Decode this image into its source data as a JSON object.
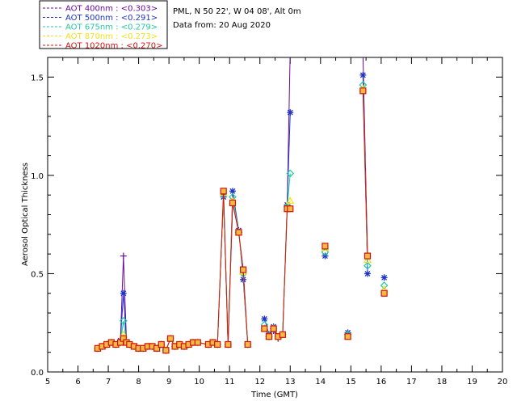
{
  "chart_data": {
    "type": "line",
    "title_lines": [
      "PML, N 50 22', W 04 08', Alt 0m",
      "Data from: 20 Aug 2020"
    ],
    "xlabel": "Time (GMT)",
    "ylabel": "Aerosol Optical Thickness",
    "xlim": [
      5,
      20
    ],
    "ylim": [
      0.0,
      1.6
    ],
    "xticks": [
      "5",
      "6",
      "7",
      "8",
      "9",
      "10",
      "11",
      "12",
      "13",
      "14",
      "15",
      "16",
      "17",
      "18",
      "19",
      "20"
    ],
    "yticks": [
      "0.0",
      "0.5",
      "1.0",
      "1.5"
    ],
    "legend_position": "top-left",
    "grid": false,
    "series": [
      {
        "name": "AOT 400nm : <0.303>",
        "color": "#6a0a9c",
        "marker": "plus",
        "points": [
          [
            6.65,
            0.12
          ],
          [
            6.8,
            0.13
          ],
          [
            6.95,
            0.14
          ],
          [
            7.1,
            0.15
          ],
          [
            7.25,
            0.14
          ],
          [
            7.4,
            0.16
          ],
          [
            7.5,
            0.59
          ],
          [
            7.6,
            0.15
          ],
          [
            7.7,
            0.14
          ],
          [
            7.85,
            0.13
          ],
          [
            8.0,
            0.12
          ],
          [
            8.15,
            0.12
          ],
          [
            8.3,
            0.13
          ],
          [
            8.45,
            0.13
          ],
          [
            8.6,
            0.12
          ],
          [
            8.75,
            0.14
          ],
          [
            8.9,
            0.11
          ],
          [
            9.05,
            0.17
          ],
          [
            9.2,
            0.13
          ],
          [
            9.35,
            0.14
          ],
          [
            9.5,
            0.13
          ],
          [
            9.65,
            0.14
          ],
          [
            9.8,
            0.15
          ],
          [
            9.95,
            0.15
          ],
          [
            10.3,
            0.14
          ],
          [
            10.45,
            0.15
          ],
          [
            10.6,
            0.14
          ],
          [
            10.8,
            0.9
          ],
          [
            10.95,
            0.14
          ],
          [
            11.1,
            0.86
          ],
          [
            11.3,
            0.71
          ],
          [
            11.45,
            0.52
          ],
          [
            11.6,
            0.14
          ],
          [
            null,
            null
          ],
          [
            12.15,
            0.22
          ],
          [
            12.3,
            0.19
          ],
          [
            12.45,
            0.21
          ],
          [
            12.6,
            0.17
          ],
          [
            12.75,
            0.19
          ],
          [
            12.9,
            0.83
          ],
          [
            13.0,
            1.65
          ],
          [
            null,
            null
          ],
          [
            15.4,
            1.62
          ],
          [
            15.55,
            0.59
          ]
        ]
      },
      {
        "name": "AOT 500nm : <0.291>",
        "color": "#1f34c9",
        "marker": "asterisk",
        "points": [
          [
            6.65,
            0.12
          ],
          [
            6.8,
            0.13
          ],
          [
            6.95,
            0.14
          ],
          [
            7.1,
            0.15
          ],
          [
            7.25,
            0.14
          ],
          [
            7.4,
            0.16
          ],
          [
            7.5,
            0.4
          ],
          [
            7.6,
            0.15
          ],
          [
            7.7,
            0.14
          ],
          [
            7.85,
            0.13
          ],
          [
            8.0,
            0.12
          ],
          [
            8.15,
            0.12
          ],
          [
            8.3,
            0.13
          ],
          [
            8.45,
            0.13
          ],
          [
            8.6,
            0.12
          ],
          [
            8.75,
            0.14
          ],
          [
            8.9,
            0.11
          ],
          [
            9.05,
            0.17
          ],
          [
            9.2,
            0.13
          ],
          [
            9.35,
            0.14
          ],
          [
            9.5,
            0.13
          ],
          [
            9.65,
            0.14
          ],
          [
            9.8,
            0.15
          ],
          [
            9.95,
            0.15
          ],
          [
            10.3,
            0.14
          ],
          [
            10.45,
            0.15
          ],
          [
            10.6,
            0.14
          ],
          [
            10.8,
            0.89
          ],
          [
            10.95,
            0.14
          ],
          [
            11.1,
            0.92
          ],
          [
            11.3,
            0.72
          ],
          [
            11.45,
            0.47
          ],
          [
            11.6,
            0.14
          ],
          [
            null,
            null
          ],
          [
            12.15,
            0.27
          ],
          [
            12.3,
            0.19
          ],
          [
            12.45,
            0.23
          ],
          [
            12.6,
            0.18
          ],
          [
            12.75,
            0.19
          ],
          [
            12.9,
            0.85
          ],
          [
            13.0,
            1.32
          ],
          [
            null,
            null
          ],
          [
            14.15,
            0.59
          ],
          [
            null,
            null
          ],
          [
            14.9,
            0.2
          ],
          [
            null,
            null
          ],
          [
            15.4,
            1.51
          ],
          [
            15.55,
            0.5
          ],
          [
            null,
            null
          ],
          [
            16.1,
            0.48
          ]
        ]
      },
      {
        "name": "AOT 675nm : <0.279>",
        "color": "#22c9a0",
        "marker": "diamond",
        "points": [
          [
            6.65,
            0.12
          ],
          [
            6.8,
            0.13
          ],
          [
            6.95,
            0.14
          ],
          [
            7.1,
            0.15
          ],
          [
            7.25,
            0.14
          ],
          [
            7.4,
            0.15
          ],
          [
            7.5,
            0.26
          ],
          [
            7.6,
            0.15
          ],
          [
            7.7,
            0.14
          ],
          [
            7.85,
            0.13
          ],
          [
            8.0,
            0.12
          ],
          [
            8.15,
            0.12
          ],
          [
            8.3,
            0.13
          ],
          [
            8.45,
            0.13
          ],
          [
            8.6,
            0.12
          ],
          [
            8.75,
            0.14
          ],
          [
            8.9,
            0.11
          ],
          [
            9.05,
            0.17
          ],
          [
            9.2,
            0.13
          ],
          [
            9.35,
            0.14
          ],
          [
            9.5,
            0.13
          ],
          [
            9.65,
            0.14
          ],
          [
            9.8,
            0.15
          ],
          [
            9.95,
            0.15
          ],
          [
            10.3,
            0.14
          ],
          [
            10.45,
            0.15
          ],
          [
            10.6,
            0.14
          ],
          [
            10.8,
            0.9
          ],
          [
            10.95,
            0.14
          ],
          [
            11.1,
            0.89
          ],
          [
            11.3,
            0.71
          ],
          [
            11.45,
            0.5
          ],
          [
            11.6,
            0.14
          ],
          [
            null,
            null
          ],
          [
            12.15,
            0.24
          ],
          [
            12.3,
            0.18
          ],
          [
            12.45,
            0.22
          ],
          [
            12.6,
            0.18
          ],
          [
            12.75,
            0.19
          ],
          [
            12.9,
            0.84
          ],
          [
            13.0,
            1.01
          ],
          [
            null,
            null
          ],
          [
            14.15,
            0.61
          ],
          [
            null,
            null
          ],
          [
            14.9,
            0.19
          ],
          [
            null,
            null
          ],
          [
            15.4,
            1.46
          ],
          [
            15.55,
            0.54
          ],
          [
            null,
            null
          ],
          [
            16.1,
            0.44
          ]
        ]
      },
      {
        "name": "AOT 870nm : <0.273>",
        "color": "#f0e21a",
        "marker": "triangle",
        "points": [
          [
            6.65,
            0.12
          ],
          [
            6.8,
            0.13
          ],
          [
            6.95,
            0.14
          ],
          [
            7.1,
            0.15
          ],
          [
            7.25,
            0.14
          ],
          [
            7.4,
            0.15
          ],
          [
            7.5,
            0.19
          ],
          [
            7.6,
            0.15
          ],
          [
            7.7,
            0.14
          ],
          [
            7.85,
            0.13
          ],
          [
            8.0,
            0.12
          ],
          [
            8.15,
            0.12
          ],
          [
            8.3,
            0.13
          ],
          [
            8.45,
            0.13
          ],
          [
            8.6,
            0.12
          ],
          [
            8.75,
            0.14
          ],
          [
            8.9,
            0.11
          ],
          [
            9.05,
            0.17
          ],
          [
            9.2,
            0.13
          ],
          [
            9.35,
            0.14
          ],
          [
            9.5,
            0.13
          ],
          [
            9.65,
            0.14
          ],
          [
            9.8,
            0.15
          ],
          [
            9.95,
            0.15
          ],
          [
            10.3,
            0.14
          ],
          [
            10.45,
            0.15
          ],
          [
            10.6,
            0.14
          ],
          [
            10.8,
            0.91
          ],
          [
            10.95,
            0.14
          ],
          [
            11.1,
            0.87
          ],
          [
            11.3,
            0.71
          ],
          [
            11.45,
            0.51
          ],
          [
            11.6,
            0.14
          ],
          [
            null,
            null
          ],
          [
            12.15,
            0.22
          ],
          [
            12.3,
            0.18
          ],
          [
            12.45,
            0.22
          ],
          [
            12.6,
            0.18
          ],
          [
            12.75,
            0.19
          ],
          [
            12.9,
            0.83
          ],
          [
            13.0,
            0.87
          ],
          [
            null,
            null
          ],
          [
            14.15,
            0.63
          ],
          [
            null,
            null
          ],
          [
            14.9,
            0.18
          ],
          [
            null,
            null
          ],
          [
            15.4,
            1.44
          ],
          [
            15.55,
            0.57
          ],
          [
            null,
            null
          ],
          [
            16.1,
            0.42
          ]
        ]
      },
      {
        "name": "AOT 1020nm : <0.270>",
        "color": "#d0140f",
        "marker": "square",
        "points": [
          [
            6.65,
            0.12
          ],
          [
            6.8,
            0.13
          ],
          [
            6.95,
            0.14
          ],
          [
            7.1,
            0.15
          ],
          [
            7.25,
            0.14
          ],
          [
            7.4,
            0.15
          ],
          [
            7.5,
            0.17
          ],
          [
            7.6,
            0.15
          ],
          [
            7.7,
            0.14
          ],
          [
            7.85,
            0.13
          ],
          [
            8.0,
            0.12
          ],
          [
            8.15,
            0.12
          ],
          [
            8.3,
            0.13
          ],
          [
            8.45,
            0.13
          ],
          [
            8.6,
            0.12
          ],
          [
            8.75,
            0.14
          ],
          [
            8.9,
            0.11
          ],
          [
            9.05,
            0.17
          ],
          [
            9.2,
            0.13
          ],
          [
            9.35,
            0.14
          ],
          [
            9.5,
            0.13
          ],
          [
            9.65,
            0.14
          ],
          [
            9.8,
            0.15
          ],
          [
            9.95,
            0.15
          ],
          [
            10.3,
            0.14
          ],
          [
            10.45,
            0.15
          ],
          [
            10.6,
            0.14
          ],
          [
            10.8,
            0.92
          ],
          [
            10.95,
            0.14
          ],
          [
            11.1,
            0.86
          ],
          [
            11.3,
            0.71
          ],
          [
            11.45,
            0.52
          ],
          [
            11.6,
            0.14
          ],
          [
            null,
            null
          ],
          [
            12.15,
            0.22
          ],
          [
            12.3,
            0.18
          ],
          [
            12.45,
            0.22
          ],
          [
            12.6,
            0.18
          ],
          [
            12.75,
            0.19
          ],
          [
            12.9,
            0.83
          ],
          [
            13.0,
            0.83
          ],
          [
            null,
            null
          ],
          [
            14.15,
            0.64
          ],
          [
            null,
            null
          ],
          [
            14.9,
            0.18
          ],
          [
            null,
            null
          ],
          [
            15.4,
            1.43
          ],
          [
            15.55,
            0.59
          ],
          [
            null,
            null
          ],
          [
            16.1,
            0.4
          ]
        ]
      }
    ]
  }
}
